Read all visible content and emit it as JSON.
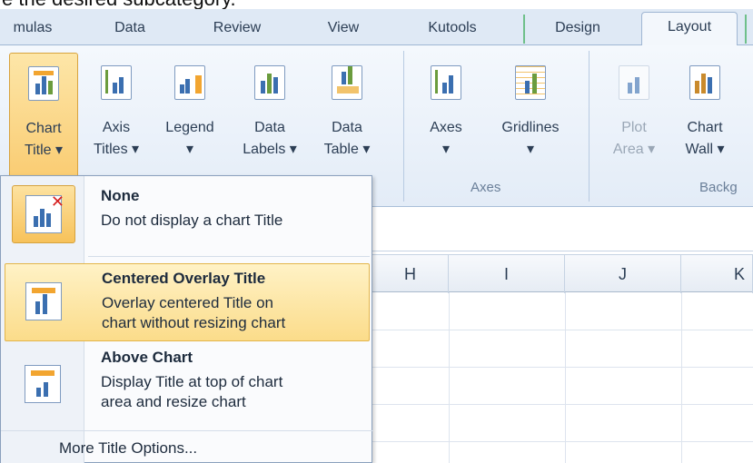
{
  "caption": {
    "text": "e the desired subcategory."
  },
  "tabs": [
    {
      "label": "mulas"
    },
    {
      "label": "Data"
    },
    {
      "label": "Review"
    },
    {
      "label": "View"
    },
    {
      "label": "Kutools"
    },
    {
      "label": "Design"
    },
    {
      "label": "Layout",
      "active": true
    }
  ],
  "ribbon": {
    "buttons": {
      "chart_title": {
        "line1": "Chart",
        "line2": "Title ▾"
      },
      "axis_titles": {
        "line1": "Axis",
        "line2": "Titles ▾"
      },
      "legend": {
        "line1": "Legend",
        "line2": "▾"
      },
      "data_labels": {
        "line1": "Data",
        "line2": "Labels ▾"
      },
      "data_table": {
        "line1": "Data",
        "line2": "Table ▾"
      },
      "axes": {
        "line1": "Axes",
        "line2": "▾"
      },
      "gridlines": {
        "line1": "Gridlines",
        "line2": "▾"
      },
      "plot_area": {
        "line1": "Plot",
        "line2": "Area ▾"
      },
      "chart_wall": {
        "line1": "Chart",
        "line2": "Wall ▾"
      }
    },
    "groups": {
      "axes": "Axes",
      "background": "Backg"
    }
  },
  "columns": [
    "H",
    "I",
    "J",
    "K"
  ],
  "menu": {
    "items": [
      {
        "title": "None",
        "desc1": "Do not display a chart Title",
        "desc2": ""
      },
      {
        "title": "Centered Overlay Title",
        "desc1": "Overlay centered Title on",
        "desc2": "chart without resizing chart"
      },
      {
        "title": "Above Chart",
        "desc1": "Display Title at top of chart",
        "desc2": "area and resize chart"
      }
    ],
    "more_options": "More Title Options..."
  },
  "colors": {
    "ribbon_bg": "#e3ecf7",
    "highlight": "#fbdc8a",
    "selected_border": "#d8a33f"
  }
}
